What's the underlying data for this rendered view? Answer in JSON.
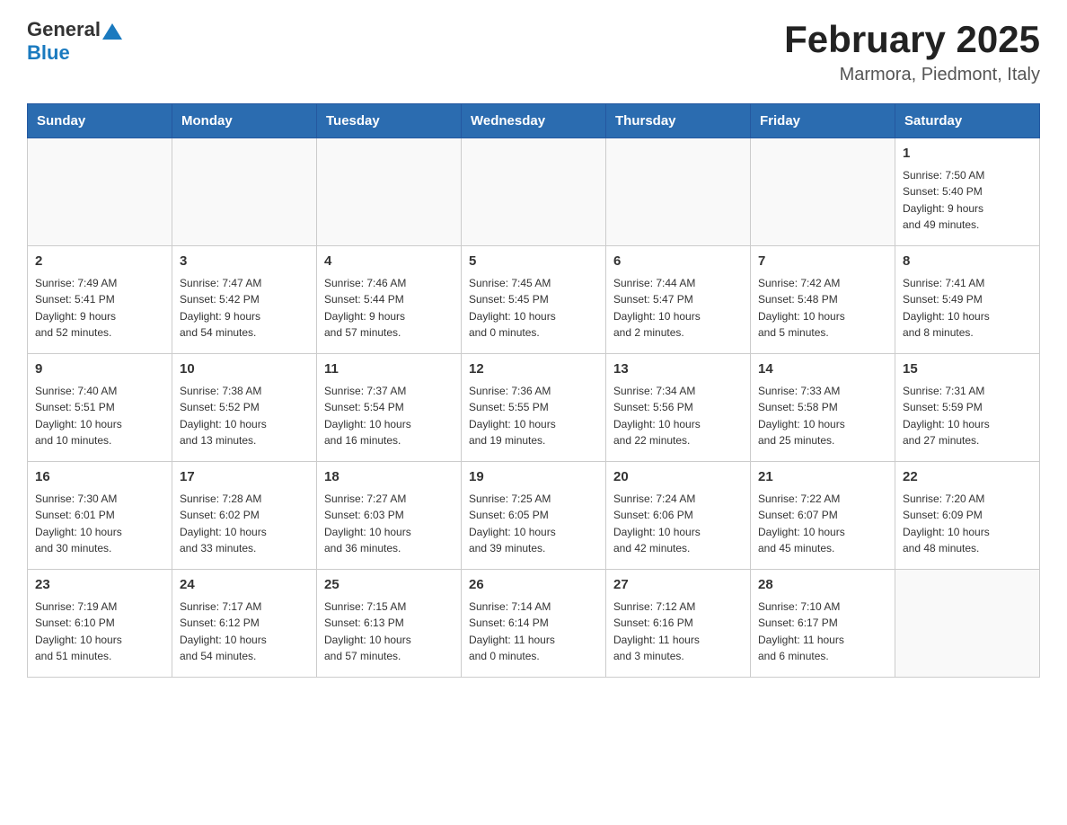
{
  "header": {
    "logo_general": "General",
    "logo_blue": "Blue",
    "title": "February 2025",
    "subtitle": "Marmora, Piedmont, Italy"
  },
  "days_of_week": [
    "Sunday",
    "Monday",
    "Tuesday",
    "Wednesday",
    "Thursday",
    "Friday",
    "Saturday"
  ],
  "weeks": [
    {
      "days": [
        {
          "num": "",
          "info": ""
        },
        {
          "num": "",
          "info": ""
        },
        {
          "num": "",
          "info": ""
        },
        {
          "num": "",
          "info": ""
        },
        {
          "num": "",
          "info": ""
        },
        {
          "num": "",
          "info": ""
        },
        {
          "num": "1",
          "info": "Sunrise: 7:50 AM\nSunset: 5:40 PM\nDaylight: 9 hours\nand 49 minutes."
        }
      ]
    },
    {
      "days": [
        {
          "num": "2",
          "info": "Sunrise: 7:49 AM\nSunset: 5:41 PM\nDaylight: 9 hours\nand 52 minutes."
        },
        {
          "num": "3",
          "info": "Sunrise: 7:47 AM\nSunset: 5:42 PM\nDaylight: 9 hours\nand 54 minutes."
        },
        {
          "num": "4",
          "info": "Sunrise: 7:46 AM\nSunset: 5:44 PM\nDaylight: 9 hours\nand 57 minutes."
        },
        {
          "num": "5",
          "info": "Sunrise: 7:45 AM\nSunset: 5:45 PM\nDaylight: 10 hours\nand 0 minutes."
        },
        {
          "num": "6",
          "info": "Sunrise: 7:44 AM\nSunset: 5:47 PM\nDaylight: 10 hours\nand 2 minutes."
        },
        {
          "num": "7",
          "info": "Sunrise: 7:42 AM\nSunset: 5:48 PM\nDaylight: 10 hours\nand 5 minutes."
        },
        {
          "num": "8",
          "info": "Sunrise: 7:41 AM\nSunset: 5:49 PM\nDaylight: 10 hours\nand 8 minutes."
        }
      ]
    },
    {
      "days": [
        {
          "num": "9",
          "info": "Sunrise: 7:40 AM\nSunset: 5:51 PM\nDaylight: 10 hours\nand 10 minutes."
        },
        {
          "num": "10",
          "info": "Sunrise: 7:38 AM\nSunset: 5:52 PM\nDaylight: 10 hours\nand 13 minutes."
        },
        {
          "num": "11",
          "info": "Sunrise: 7:37 AM\nSunset: 5:54 PM\nDaylight: 10 hours\nand 16 minutes."
        },
        {
          "num": "12",
          "info": "Sunrise: 7:36 AM\nSunset: 5:55 PM\nDaylight: 10 hours\nand 19 minutes."
        },
        {
          "num": "13",
          "info": "Sunrise: 7:34 AM\nSunset: 5:56 PM\nDaylight: 10 hours\nand 22 minutes."
        },
        {
          "num": "14",
          "info": "Sunrise: 7:33 AM\nSunset: 5:58 PM\nDaylight: 10 hours\nand 25 minutes."
        },
        {
          "num": "15",
          "info": "Sunrise: 7:31 AM\nSunset: 5:59 PM\nDaylight: 10 hours\nand 27 minutes."
        }
      ]
    },
    {
      "days": [
        {
          "num": "16",
          "info": "Sunrise: 7:30 AM\nSunset: 6:01 PM\nDaylight: 10 hours\nand 30 minutes."
        },
        {
          "num": "17",
          "info": "Sunrise: 7:28 AM\nSunset: 6:02 PM\nDaylight: 10 hours\nand 33 minutes."
        },
        {
          "num": "18",
          "info": "Sunrise: 7:27 AM\nSunset: 6:03 PM\nDaylight: 10 hours\nand 36 minutes."
        },
        {
          "num": "19",
          "info": "Sunrise: 7:25 AM\nSunset: 6:05 PM\nDaylight: 10 hours\nand 39 minutes."
        },
        {
          "num": "20",
          "info": "Sunrise: 7:24 AM\nSunset: 6:06 PM\nDaylight: 10 hours\nand 42 minutes."
        },
        {
          "num": "21",
          "info": "Sunrise: 7:22 AM\nSunset: 6:07 PM\nDaylight: 10 hours\nand 45 minutes."
        },
        {
          "num": "22",
          "info": "Sunrise: 7:20 AM\nSunset: 6:09 PM\nDaylight: 10 hours\nand 48 minutes."
        }
      ]
    },
    {
      "days": [
        {
          "num": "23",
          "info": "Sunrise: 7:19 AM\nSunset: 6:10 PM\nDaylight: 10 hours\nand 51 minutes."
        },
        {
          "num": "24",
          "info": "Sunrise: 7:17 AM\nSunset: 6:12 PM\nDaylight: 10 hours\nand 54 minutes."
        },
        {
          "num": "25",
          "info": "Sunrise: 7:15 AM\nSunset: 6:13 PM\nDaylight: 10 hours\nand 57 minutes."
        },
        {
          "num": "26",
          "info": "Sunrise: 7:14 AM\nSunset: 6:14 PM\nDaylight: 11 hours\nand 0 minutes."
        },
        {
          "num": "27",
          "info": "Sunrise: 7:12 AM\nSunset: 6:16 PM\nDaylight: 11 hours\nand 3 minutes."
        },
        {
          "num": "28",
          "info": "Sunrise: 7:10 AM\nSunset: 6:17 PM\nDaylight: 11 hours\nand 6 minutes."
        },
        {
          "num": "",
          "info": ""
        }
      ]
    }
  ]
}
